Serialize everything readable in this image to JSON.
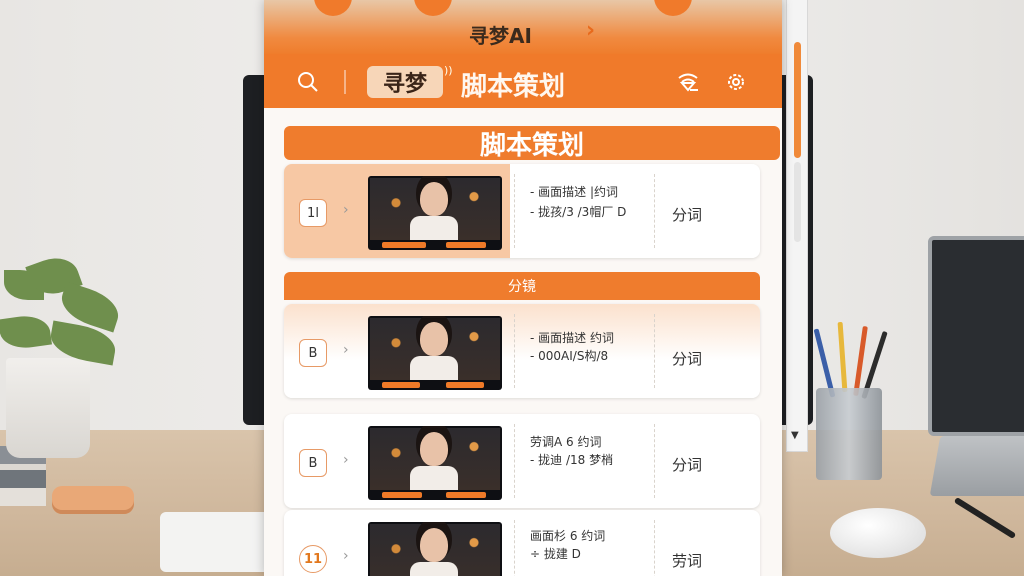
{
  "banner": {
    "title": "寻梦AI",
    "arrow": "›"
  },
  "header": {
    "brand": "寻梦",
    "title": "脚本策划",
    "icons": [
      "search-icon",
      "wifi-filter-icon",
      "gear-icon"
    ]
  },
  "section": {
    "title": "脚本策划"
  },
  "subsection": {
    "title": "分镜"
  },
  "rows": [
    {
      "badge": "1l",
      "lines": [
        "- 画面描述 |约词",
        "- 拢孩/3  /3帽厂 D"
      ],
      "label": "分词"
    },
    {
      "badge": "B",
      "lines": [
        "- 画面描述 约词",
        "- 000AI/S构/8"
      ],
      "label": "分词"
    },
    {
      "badge": "B",
      "lines": [
        "劳调A 6 约词",
        "- 拢迪 /18   梦梢"
      ],
      "label": "分词"
    },
    {
      "badge": "11",
      "lines": [
        "画面杉 6 约词",
        "÷ 拢建 D"
      ],
      "label": "劳词"
    }
  ],
  "colors": {
    "accent": "#ef7c2d",
    "accent_light": "#f7c8a4"
  }
}
